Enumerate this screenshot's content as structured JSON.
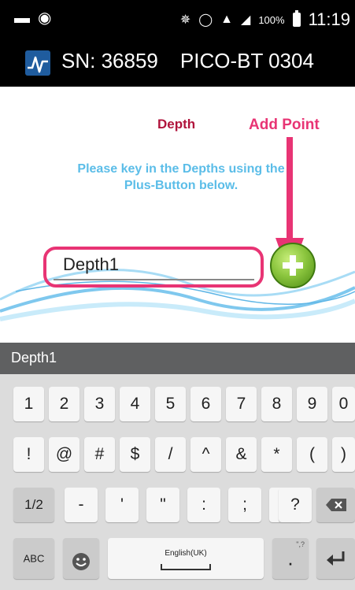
{
  "status_bar": {
    "battery": "100%",
    "time": "11:19"
  },
  "app_bar": {
    "serial": "SN: 36859",
    "device": "PICO-BT 0304"
  },
  "content": {
    "heading": "Depth",
    "annotation": "Add Point",
    "instructions_line1": "Please key in the Depths using the",
    "instructions_line2": "Plus-Button below."
  },
  "depth_input": {
    "value": "Depth1"
  },
  "suggestion_bar": {
    "text": "Depth1"
  },
  "keyboard": {
    "row1": [
      "1",
      "2",
      "3",
      "4",
      "5",
      "6",
      "7",
      "8",
      "9",
      "0"
    ],
    "row2": [
      "!",
      "@",
      "#",
      "$",
      "/",
      "^",
      "&",
      "*",
      "(",
      ")"
    ],
    "row3": {
      "page": "1/2",
      "keys": [
        "-",
        "'",
        "\"",
        ":",
        ";",
        ",",
        "?"
      ]
    },
    "row4": {
      "abc": "ABC",
      "space": "English(UK)",
      "period": ".",
      "period_hint": "\",?"
    }
  },
  "colors": {
    "accent_pink": "#e83474",
    "heading_red": "#b0143c",
    "instruction_blue": "#5bbde8",
    "plus_green": "#8cc63f"
  }
}
